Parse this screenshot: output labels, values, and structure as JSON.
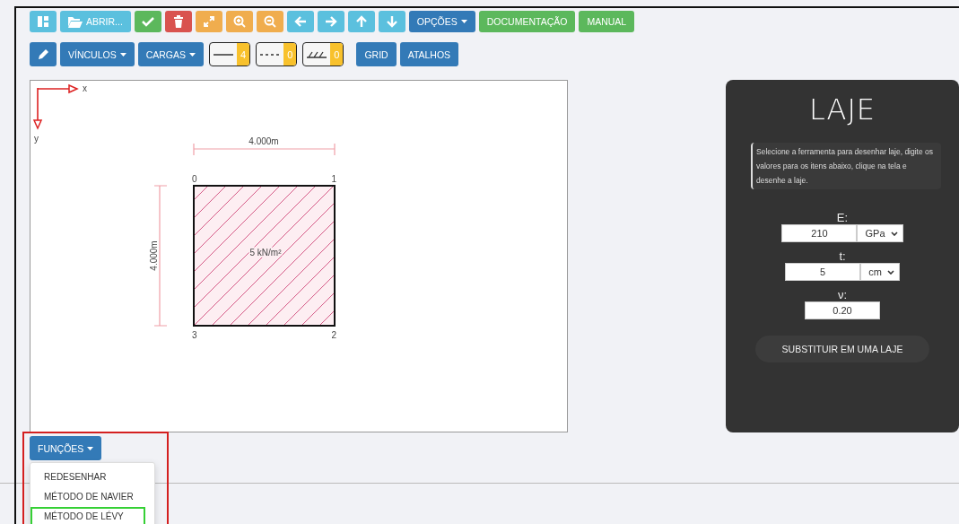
{
  "toolbar": [
    [
      {
        "kind": "icon"
      },
      {
        "kind": "icon-text",
        "label": "ABRIR..."
      },
      {
        "kind": "icon"
      },
      {
        "kind": "icon"
      },
      {
        "kind": "icon"
      },
      {
        "kind": "icon"
      },
      {
        "kind": "icon"
      },
      {
        "kind": "icon"
      },
      {
        "kind": "icon"
      },
      {
        "kind": "icon"
      },
      {
        "kind": "icon"
      },
      {
        "kind": "dropdown",
        "label": "OPÇÕES"
      },
      {
        "kind": "text",
        "label": "DOCUMENTAÇÃO"
      },
      {
        "kind": "text",
        "label": "MANUAL"
      }
    ],
    [
      {
        "kind": "icon"
      },
      {
        "kind": "dropdown",
        "label": "VÍNCULOS"
      },
      {
        "kind": "dropdown",
        "label": "CARGAS"
      },
      {
        "kind": "counter",
        "label": "4"
      },
      {
        "kind": "counter",
        "label": "0"
      },
      {
        "kind": "counter",
        "label": "0"
      },
      {
        "kind": "text",
        "label": "GRID"
      },
      {
        "kind": "text",
        "label": "ATALHOS"
      }
    ]
  ],
  "canvas": {
    "axis_x": "x",
    "axis_y": "y",
    "width_dimension": "4.000m",
    "height_dimension": "4.000m",
    "nodes": [
      "0",
      "1",
      "3",
      "2"
    ],
    "load": "5 kN/m²"
  },
  "panel": {
    "title": "LAJE",
    "note": "Selecione a ferramenta para desenhar laje, digite os valores para os itens abaixo, clique na tela e desenhe a laje.",
    "fields": [
      {
        "label": "E:",
        "value": "210",
        "unit": "GPa"
      },
      {
        "label": "t:",
        "value": "5",
        "unit": "cm"
      },
      {
        "label": "ν:",
        "value": "0.20"
      }
    ],
    "button": "SUBSTITUIR EM UMA LAJE"
  },
  "functions": {
    "label": "FUNÇÕES",
    "items": [
      {
        "label": "REDESENHAR",
        "highlighted": false
      },
      {
        "label": "MÉTODO DE NAVIER",
        "highlighted": false
      },
      {
        "label": "MÉTODO DE LÉVY",
        "highlighted": true
      }
    ]
  }
}
